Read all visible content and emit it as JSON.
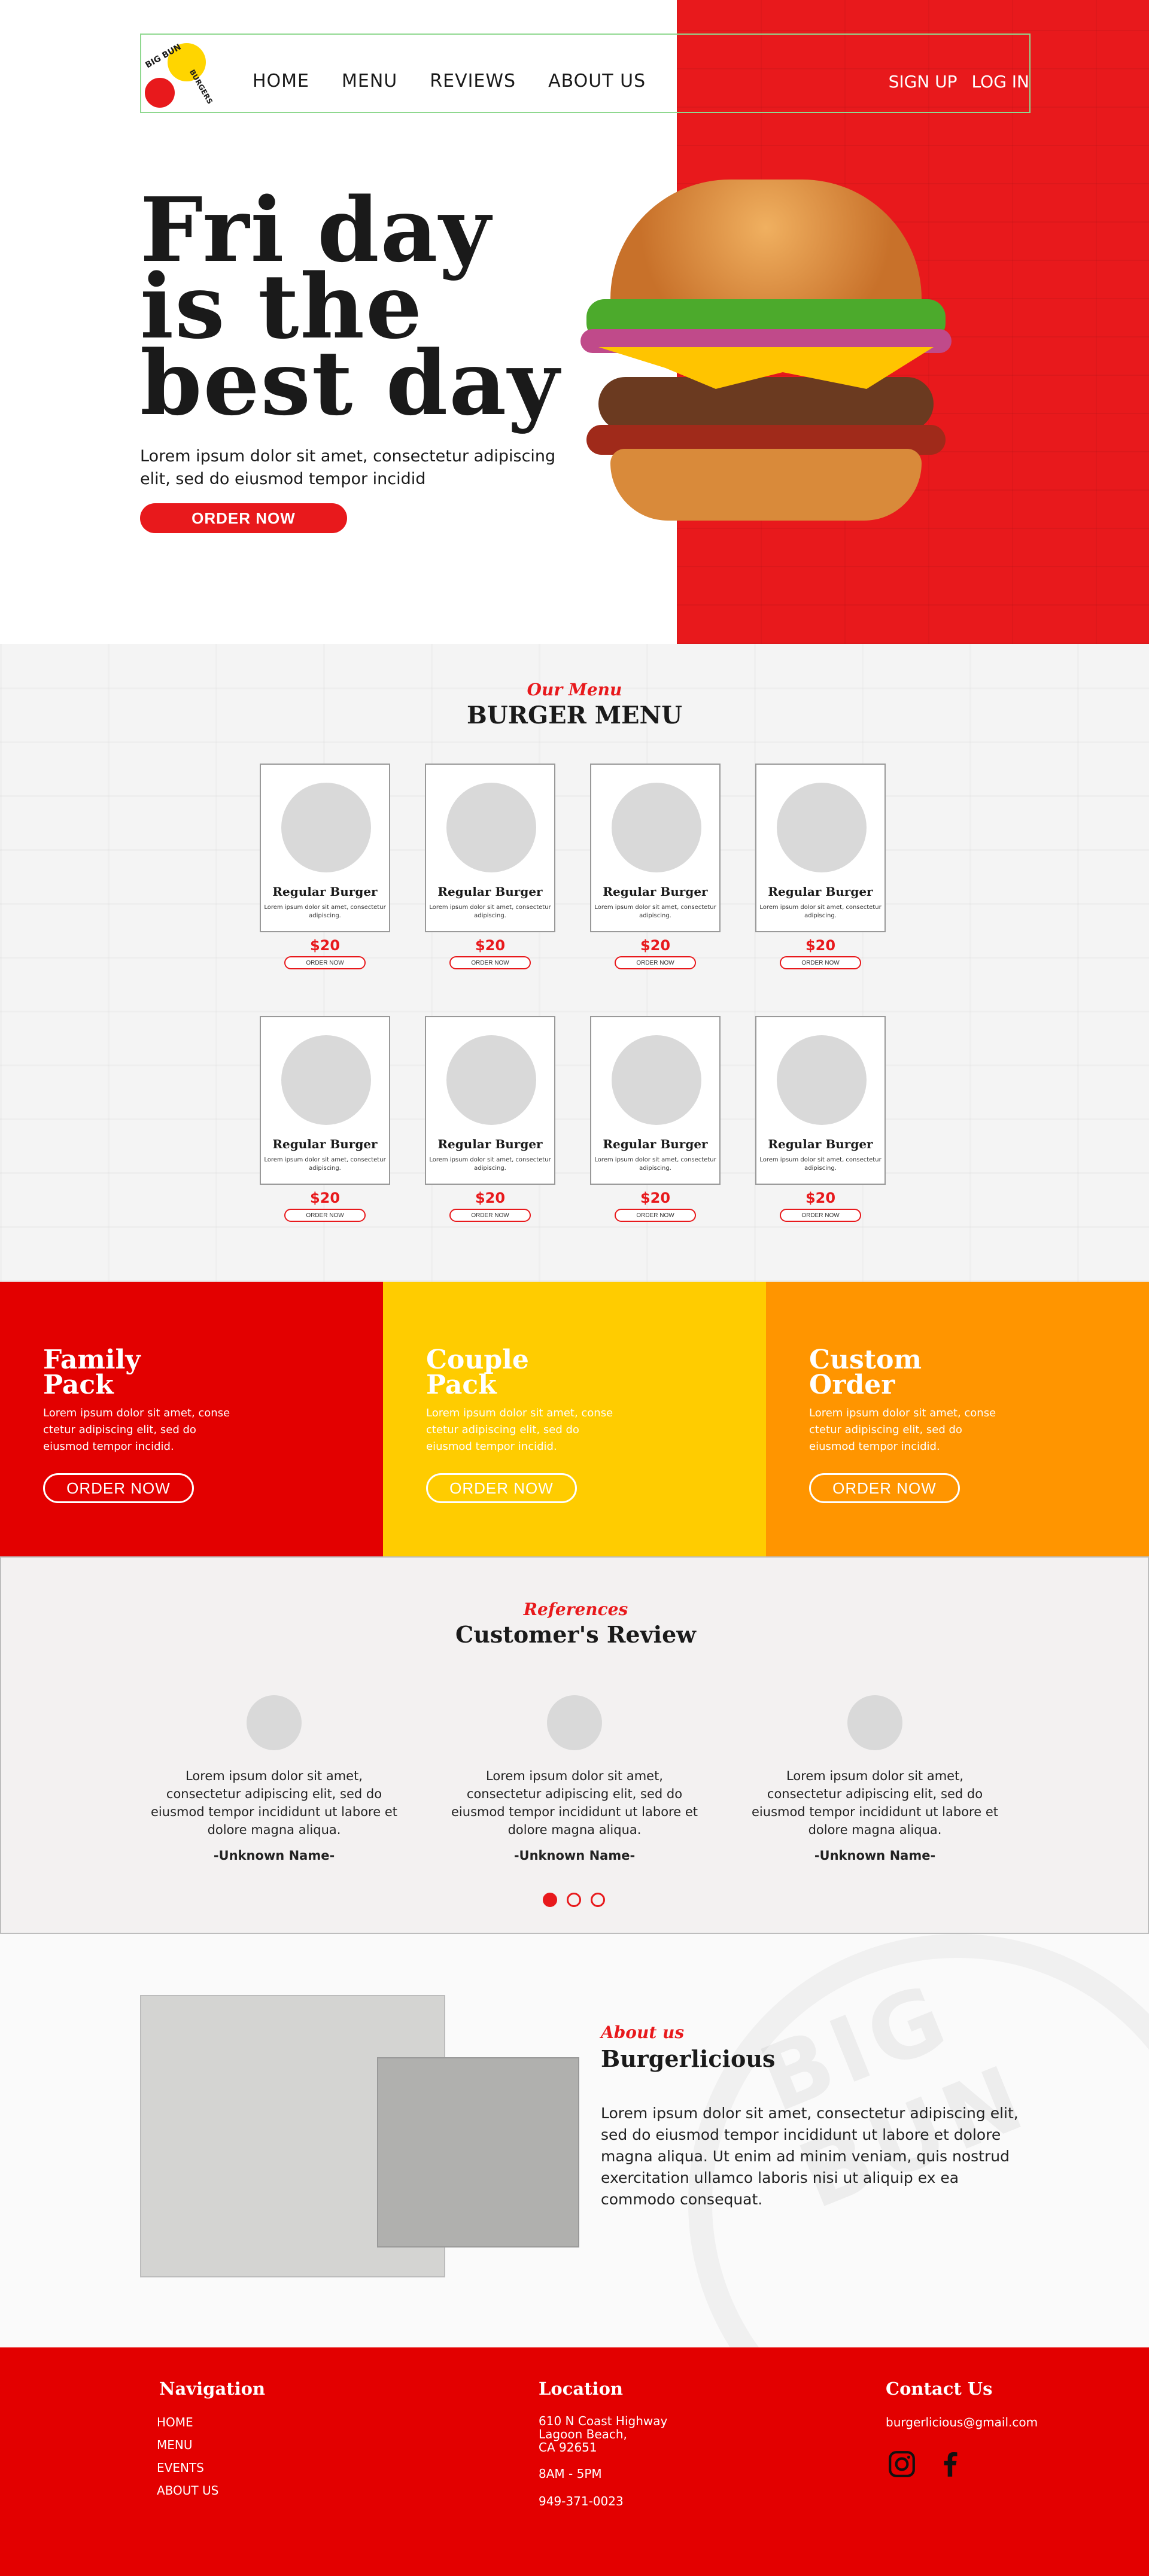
{
  "nav": {
    "items": [
      "HOME",
      "MENU",
      "REVIEWS",
      "ABOUT US"
    ],
    "signup": "SIGN UP",
    "login": "LOG IN",
    "logo_text_a": "BIG BUN",
    "logo_text_b": "BURGERS"
  },
  "hero": {
    "title_line1": "Fri day",
    "title_line2": "is the",
    "title_line3": "best day",
    "subtitle": "Lorem ipsum dolor sit amet, consectetur adipiscing elit, sed do eiusmod tempor incidid",
    "cta": "ORDER NOW"
  },
  "menu": {
    "kicker": "Our Menu",
    "title": "BURGER MENU",
    "items": [
      {
        "name": "Regular Burger",
        "desc": "Lorem ipsum dolor sit amet, consectetur adipiscing.",
        "price": "$20",
        "cta": "ORDER NOW"
      },
      {
        "name": "Regular Burger",
        "desc": "Lorem ipsum dolor sit amet, consectetur adipiscing.",
        "price": "$20",
        "cta": "ORDER NOW"
      },
      {
        "name": "Regular Burger",
        "desc": "Lorem ipsum dolor sit amet, consectetur adipiscing.",
        "price": "$20",
        "cta": "ORDER NOW"
      },
      {
        "name": "Regular Burger",
        "desc": "Lorem ipsum dolor sit amet, consectetur adipiscing.",
        "price": "$20",
        "cta": "ORDER NOW"
      },
      {
        "name": "Regular Burger",
        "desc": "Lorem ipsum dolor sit amet, consectetur adipiscing.",
        "price": "$20",
        "cta": "ORDER NOW"
      },
      {
        "name": "Regular Burger",
        "desc": "Lorem ipsum dolor sit amet, consectetur adipiscing.",
        "price": "$20",
        "cta": "ORDER NOW"
      },
      {
        "name": "Regular Burger",
        "desc": "Lorem ipsum dolor sit amet, consectetur adipiscing.",
        "price": "$20",
        "cta": "ORDER NOW"
      },
      {
        "name": "Regular Burger",
        "desc": "Lorem ipsum dolor sit amet, consectetur adipiscing.",
        "price": "$20",
        "cta": "ORDER NOW"
      }
    ]
  },
  "packs": [
    {
      "title_a": "Family",
      "title_b": "Pack",
      "desc": "Lorem ipsum dolor sit amet, conse ctetur adipiscing elit, sed do eiusmod tempor incidid.",
      "cta": "ORDER NOW",
      "color": "#e30000"
    },
    {
      "title_a": "Couple",
      "title_b": "Pack",
      "desc": "Lorem ipsum dolor sit amet, conse ctetur adipiscing elit, sed do eiusmod tempor incidid.",
      "cta": "ORDER NOW",
      "color": "#ffcc00"
    },
    {
      "title_a": "Custom",
      "title_b": "Order",
      "desc": "Lorem ipsum dolor sit amet, conse ctetur adipiscing elit, sed do eiusmod tempor incidid.",
      "cta": "ORDER NOW",
      "color": "#ff9500"
    }
  ],
  "reviews": {
    "kicker": "References",
    "title": "Customer's Review",
    "items": [
      {
        "text": "Lorem ipsum dolor sit amet, consectetur adipiscing elit, sed do eiusmod tempor incididunt ut labore et dolore magna aliqua.",
        "author": "-Unknown Name-"
      },
      {
        "text": "Lorem ipsum dolor sit amet, consectetur adipiscing elit, sed do eiusmod tempor incididunt ut labore et dolore magna aliqua.",
        "author": "-Unknown Name-"
      },
      {
        "text": "Lorem ipsum dolor sit amet, consectetur adipiscing elit, sed do eiusmod tempor incididunt ut labore et dolore magna aliqua.",
        "author": "-Unknown Name-"
      }
    ],
    "active_slide": 1,
    "slide_count": 3
  },
  "about": {
    "kicker": "About us",
    "title": "Burgerlicious",
    "text": "Lorem ipsum dolor sit amet, consectetur adipiscing elit, sed do eiusmod tempor incididunt ut labore et dolore magna aliqua. Ut enim ad minim veniam, quis nostrud exercitation ullamco laboris nisi ut aliquip ex ea commodo consequat.",
    "watermark": "BIG BUN"
  },
  "footer": {
    "nav_title": "Navigation",
    "nav_items": [
      "HOME",
      "MENU",
      "EVENTS",
      "ABOUT US"
    ],
    "location_title": "Location",
    "address_1": "610 N Coast Highway",
    "address_2": "Lagoon Beach,",
    "address_3": "CA 92651",
    "hours": "8AM - 5PM",
    "phone": "949-371-0023",
    "contact_title": "Contact Us",
    "email": "burgerlicious@gmail.com",
    "social_icons": [
      "instagram-icon",
      "facebook-icon"
    ]
  },
  "colors": {
    "brand_red": "#e8191c",
    "footer_red": "#e30000",
    "yellow": "#ffcc00",
    "orange": "#ff9500"
  }
}
